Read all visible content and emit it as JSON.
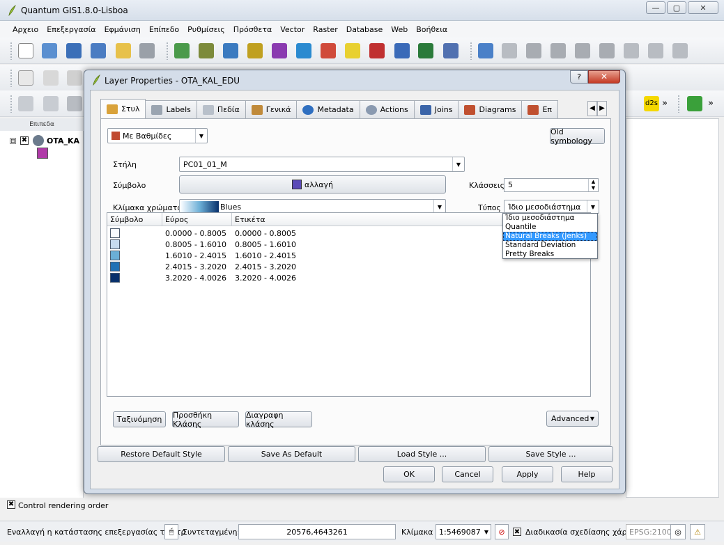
{
  "app": {
    "title": "Quantum GIS1.8.0-Lisboa",
    "window_buttons": {
      "minimize": "—",
      "maximize": "▢",
      "close": "✕"
    }
  },
  "menu": [
    "Αρχειο",
    "Επεξεργασία",
    "Εφμάνιση",
    "Επίπεδο",
    "Ρυθμίσεις",
    "Πρόσθετα",
    "Vector",
    "Raster",
    "Database",
    "Web",
    "Βοήθεια"
  ],
  "toolbar": {
    "d2s_label": "d2s",
    "overflow": "»"
  },
  "layers_panel": {
    "header": "Επιπεδα",
    "layer_name": "OTA_KA",
    "expand": "⊟",
    "checked": "✖",
    "swatch_color": "#b03aa8"
  },
  "render_order": {
    "label": "Control rendering order",
    "checked": "✖"
  },
  "status_bar": {
    "message": "Εναλλαγή η κατάστασης επεξεργασίας του τρ",
    "coord_label": "Συντεταγμένη:",
    "coord_value": "20576,4643261",
    "scale_label": "Κλίμακα",
    "scale_value": "1:5469087",
    "render_check": "✖",
    "render_label": "Διαδικασία σχεδίασης χάρτη",
    "crs": "EPSG:2100"
  },
  "dialog": {
    "title": "Layer Properties - OTA_KAL_EDU",
    "help_label": "?",
    "close_label": "✕",
    "tabs": [
      {
        "label": "Στυλ",
        "icon": "style-icon"
      },
      {
        "label": "Labels",
        "icon": "labels-icon"
      },
      {
        "label": "Πεδία",
        "icon": "fields-icon"
      },
      {
        "label": "Γενικά",
        "icon": "general-icon"
      },
      {
        "label": "Metadata",
        "icon": "metadata-icon"
      },
      {
        "label": "Actions",
        "icon": "actions-icon"
      },
      {
        "label": "Joins",
        "icon": "joins-icon"
      },
      {
        "label": "Diagrams",
        "icon": "diagrams-icon"
      },
      {
        "label": "Επ",
        "icon": "overlay-icon"
      }
    ],
    "tab_scroll_left": "◀",
    "tab_scroll_right": "▶",
    "renderer_combo": "Με Βαθμίδες",
    "old_symbology": "Old symbology",
    "column_label": "Στήλη",
    "column_value": "PC01_01_M",
    "symbol_label": "Σύμβολο",
    "symbol_change": "αλλαγή",
    "symbol_color": "#5b4ab8",
    "classes_label": "Κλάσσεις",
    "classes_value": "5",
    "ramp_label": "Κλίμακα χρώματος",
    "ramp_value": "Blues",
    "mode_label": "Τύπος",
    "mode_value": "Ίδιο μεσοδιάστημα",
    "table_headers": [
      "Σύμβολο",
      "Εύρος",
      "Ετικέτα"
    ],
    "classes": [
      {
        "color": "#f7fbff",
        "range": "0.0000 - 0.8005",
        "label": "0.0000 - 0.8005"
      },
      {
        "color": "#c6dbef",
        "range": "0.8005 - 1.6010",
        "label": "0.8005 - 1.6010"
      },
      {
        "color": "#6baed6",
        "range": "1.6010 - 2.4015",
        "label": "1.6010 - 2.4015"
      },
      {
        "color": "#2171b5",
        "range": "2.4015 - 3.2020",
        "label": "2.4015 - 3.2020"
      },
      {
        "color": "#08306b",
        "range": "3.2020 - 4.0026",
        "label": "3.2020 - 4.0026"
      }
    ],
    "mode_options": [
      "Ίδιο μεσοδιάστημα",
      "Quantile",
      "Natural Breaks (Jenks)",
      "Standard Deviation",
      "Pretty Breaks"
    ],
    "mode_highlighted": "Natural Breaks (Jenks)",
    "classify_button": "Ταξινόμηση",
    "add_class_button": "Προσθήκη Κλάσης",
    "delete_class_button": "Διαγραφη κλάσης",
    "advanced_button": "Advanced",
    "restore_default": "Restore Default Style",
    "save_default": "Save As Default",
    "load_style": "Load Style ...",
    "save_style": "Save Style ...",
    "ok": "OK",
    "cancel": "Cancel",
    "apply": "Apply",
    "help": "Help"
  }
}
